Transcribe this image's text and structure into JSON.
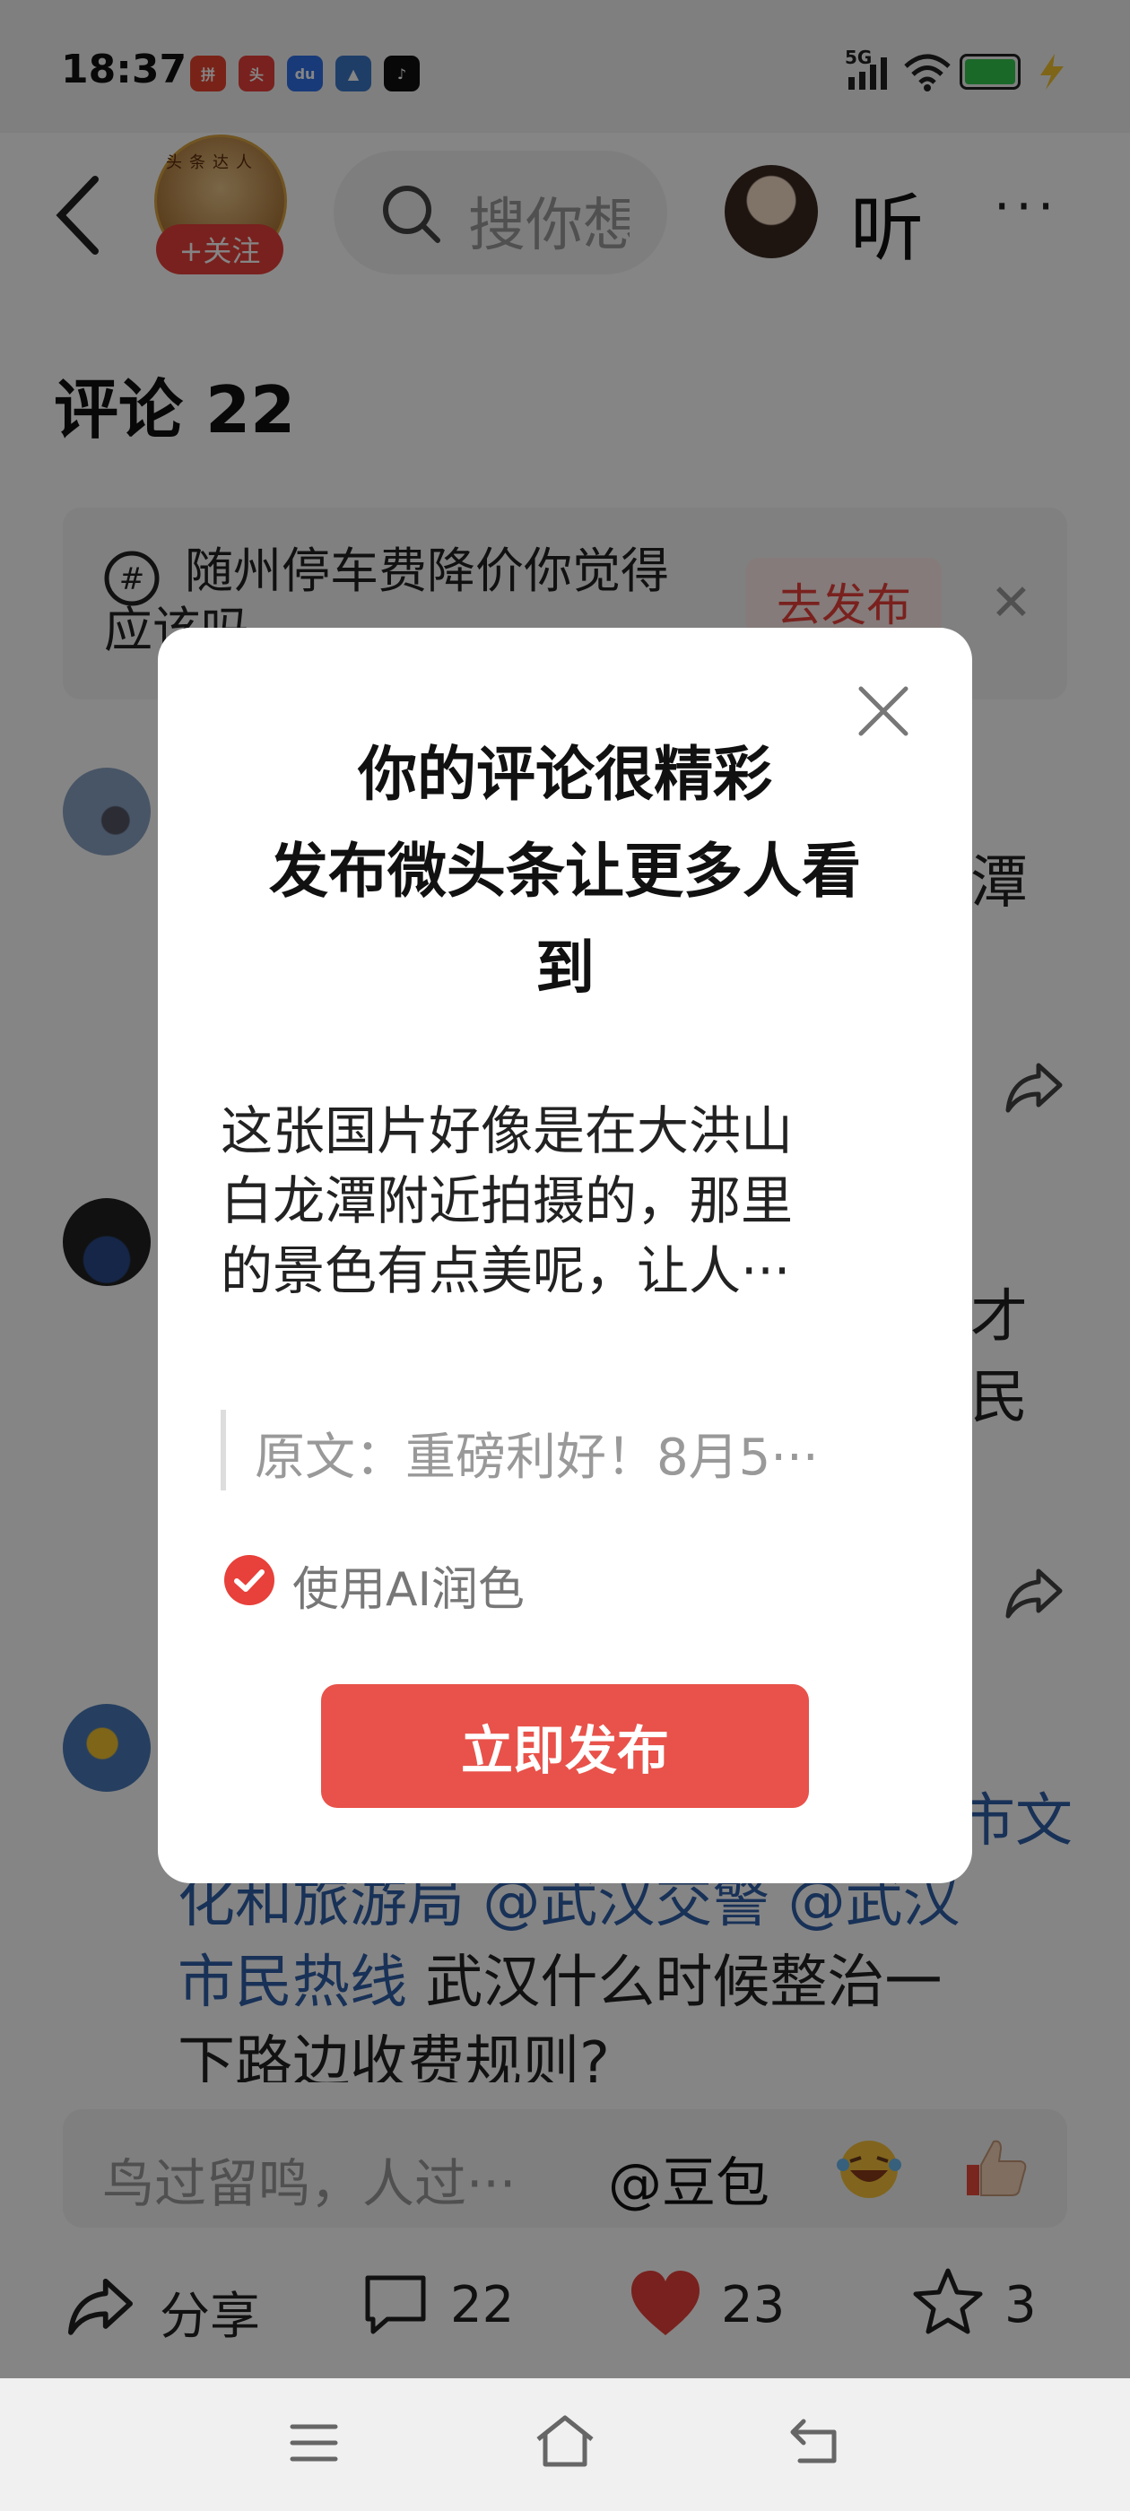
{
  "status_bar": {
    "time": "18:37",
    "apps": [
      "拼多多",
      "头条",
      "百度",
      "游戏",
      "抖音"
    ],
    "network": "5G"
  },
  "header": {
    "avatar_badge": "头条达人",
    "follow_label": "+关注",
    "search_placeholder": "搜你想",
    "listen_label": "听",
    "more_label": "···"
  },
  "comments_section": {
    "title": "评论 22"
  },
  "topic_banner": {
    "text": "随州停车费降价你觉得应该吗",
    "button_label": "去发布",
    "close_label": "✕"
  },
  "comments": [
    {
      "partial_text": "潭"
    },
    {
      "partial_text_line1": "才",
      "partial_text_line2": "民"
    },
    {
      "line1_blue": "市文",
      "line2_blue": "化和旅游局 @武汉交警 @武汉",
      "line3_blue": "市民热线",
      "line3_black": " 武汉什么时候整治一",
      "line4": "下路边收费规则?"
    }
  ],
  "comment_input": {
    "placeholder": "鸟过留鸣，人过···",
    "mention": "@豆包"
  },
  "action_bar": {
    "share_label": "分享",
    "comment_count": "22",
    "like_count": "23",
    "favorite_count": "3"
  },
  "dialog": {
    "title_line1": "你的评论很精彩",
    "title_line2": "发布微头条让更多人看",
    "title_line3": "到",
    "body_line1": "这张国片好像是在大洪山",
    "body_line2": "白龙潭附近拍摄的，那里",
    "body_line3": "的景色有点美呢，让人···",
    "quote": "原文：重磅利好！8月5···",
    "ai_polish_label": "使用AI润色",
    "ai_polish_checked": true,
    "publish_label": "立即发布",
    "accent_color": "#e8524a"
  }
}
